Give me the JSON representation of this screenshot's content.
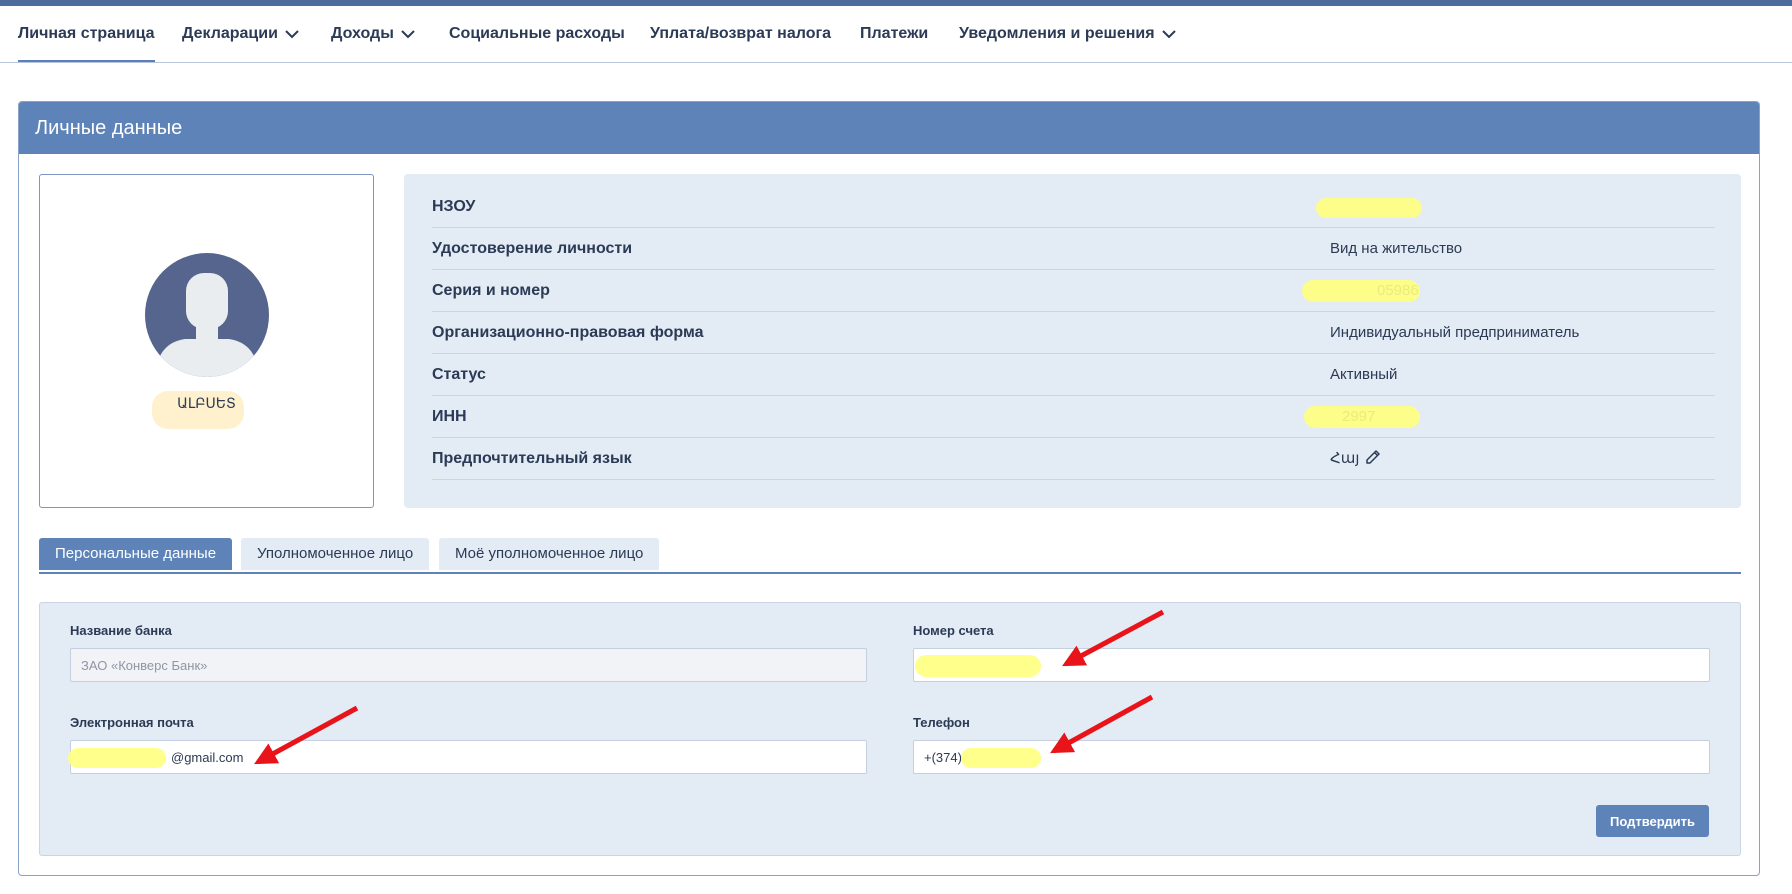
{
  "nav": {
    "items": [
      {
        "label": "Личная страница",
        "active": true,
        "dropdown": false
      },
      {
        "label": "Декларации",
        "active": false,
        "dropdown": true
      },
      {
        "label": "Доходы",
        "active": false,
        "dropdown": true
      },
      {
        "label": "Социальные расходы",
        "active": false,
        "dropdown": false
      },
      {
        "label": "Уплата/возврат налога",
        "active": false,
        "dropdown": false
      },
      {
        "label": "Платежи",
        "active": false,
        "dropdown": false
      },
      {
        "label": "Уведомления и решения",
        "active": false,
        "dropdown": true
      }
    ]
  },
  "panel": {
    "title": "Личные данные"
  },
  "profile": {
    "name_visible": "ԱԼԲՍԵՏ"
  },
  "info": {
    "rows": [
      {
        "label": "НЗОУ",
        "value": ""
      },
      {
        "label": "Удостоверение личности",
        "value": "Вид на жительство"
      },
      {
        "label": "Серия и номер",
        "value": "05986"
      },
      {
        "label": "Организационно-правовая форма",
        "value": "Индивидуальный предприниматель"
      },
      {
        "label": "Статус",
        "value": "Активный"
      },
      {
        "label": "ИНН",
        "value": "2997"
      },
      {
        "label": "Предпочтительный язык",
        "value": "Հայ"
      }
    ]
  },
  "tabs": [
    {
      "label": "Персональные данные",
      "active": true
    },
    {
      "label": "Уполномоченное лицо",
      "active": false
    },
    {
      "label": "Моё уполномоченное лицо",
      "active": false
    }
  ],
  "form": {
    "bank_label": "Название банка",
    "bank_value": "ЗАО «Конверс Банк»",
    "account_label": "Номер счета",
    "account_value": "",
    "email_label": "Электронная почта",
    "email_value": "@gmail.com",
    "phone_label": "Телефон",
    "phone_value": "+(374)",
    "submit_label": "Подтвердить"
  },
  "colors": {
    "accent": "#5d83b8",
    "panel_bg": "#e3ebf5",
    "highlight": "#ffff7e",
    "annotation": "#e8141a"
  },
  "icons": [
    "chevron-down-icon",
    "user-silhouette-icon",
    "pencil-icon",
    "red-arrow-annotation"
  ]
}
